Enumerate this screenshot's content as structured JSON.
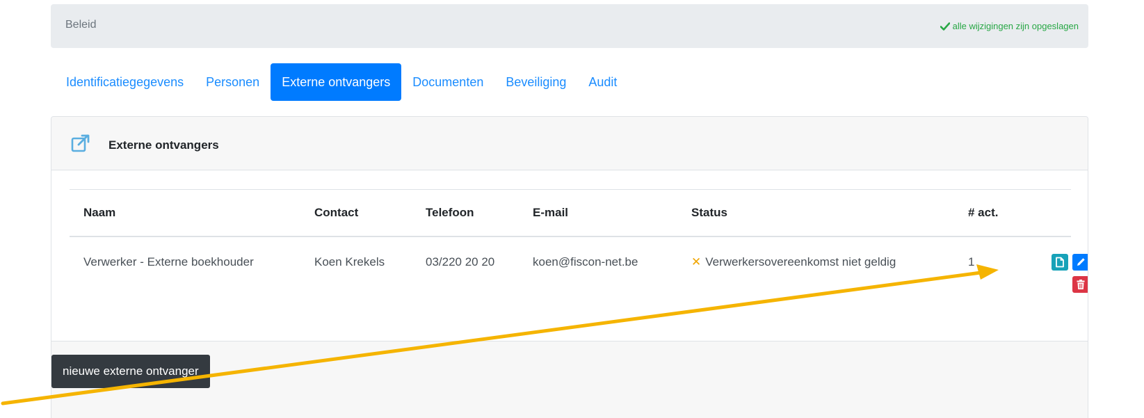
{
  "header": {
    "breadcrumb": "Beleid",
    "saved_status": "alle wijzigingen zijn opgeslagen"
  },
  "tabs": [
    {
      "label": "Identificatiegegevens",
      "active": false
    },
    {
      "label": "Personen",
      "active": false
    },
    {
      "label": "Externe ontvangers",
      "active": true
    },
    {
      "label": "Documenten",
      "active": false
    },
    {
      "label": "Beveiliging",
      "active": false
    },
    {
      "label": "Audit",
      "active": false
    }
  ],
  "card": {
    "title": "Externe ontvangers",
    "table": {
      "columns": [
        "Naam",
        "Contact",
        "Telefoon",
        "E-mail",
        "Status",
        "# act."
      ],
      "rows": [
        {
          "naam": "Verwerker - Externe boekhouder",
          "contact": "Koen Krekels",
          "telefoon": "03/220 20 20",
          "email": "koen@fiscon-net.be",
          "status": "Verwerkersovereenkomst niet geldig",
          "act": "1"
        }
      ]
    },
    "new_button": "nieuwe externe ontvanger"
  },
  "icons": {
    "saved": "check-icon",
    "header": "external-link-icon",
    "view": "document-icon",
    "edit": "pencil-icon",
    "delete": "trash-icon",
    "status": "cross-icon"
  },
  "colors": {
    "primary": "#007bff",
    "success": "#28a745",
    "info": "#17a2b8",
    "danger": "#dc3545",
    "warning": "#f0a500",
    "dark": "#343a40",
    "annotation_arrow": "#f5b400"
  }
}
